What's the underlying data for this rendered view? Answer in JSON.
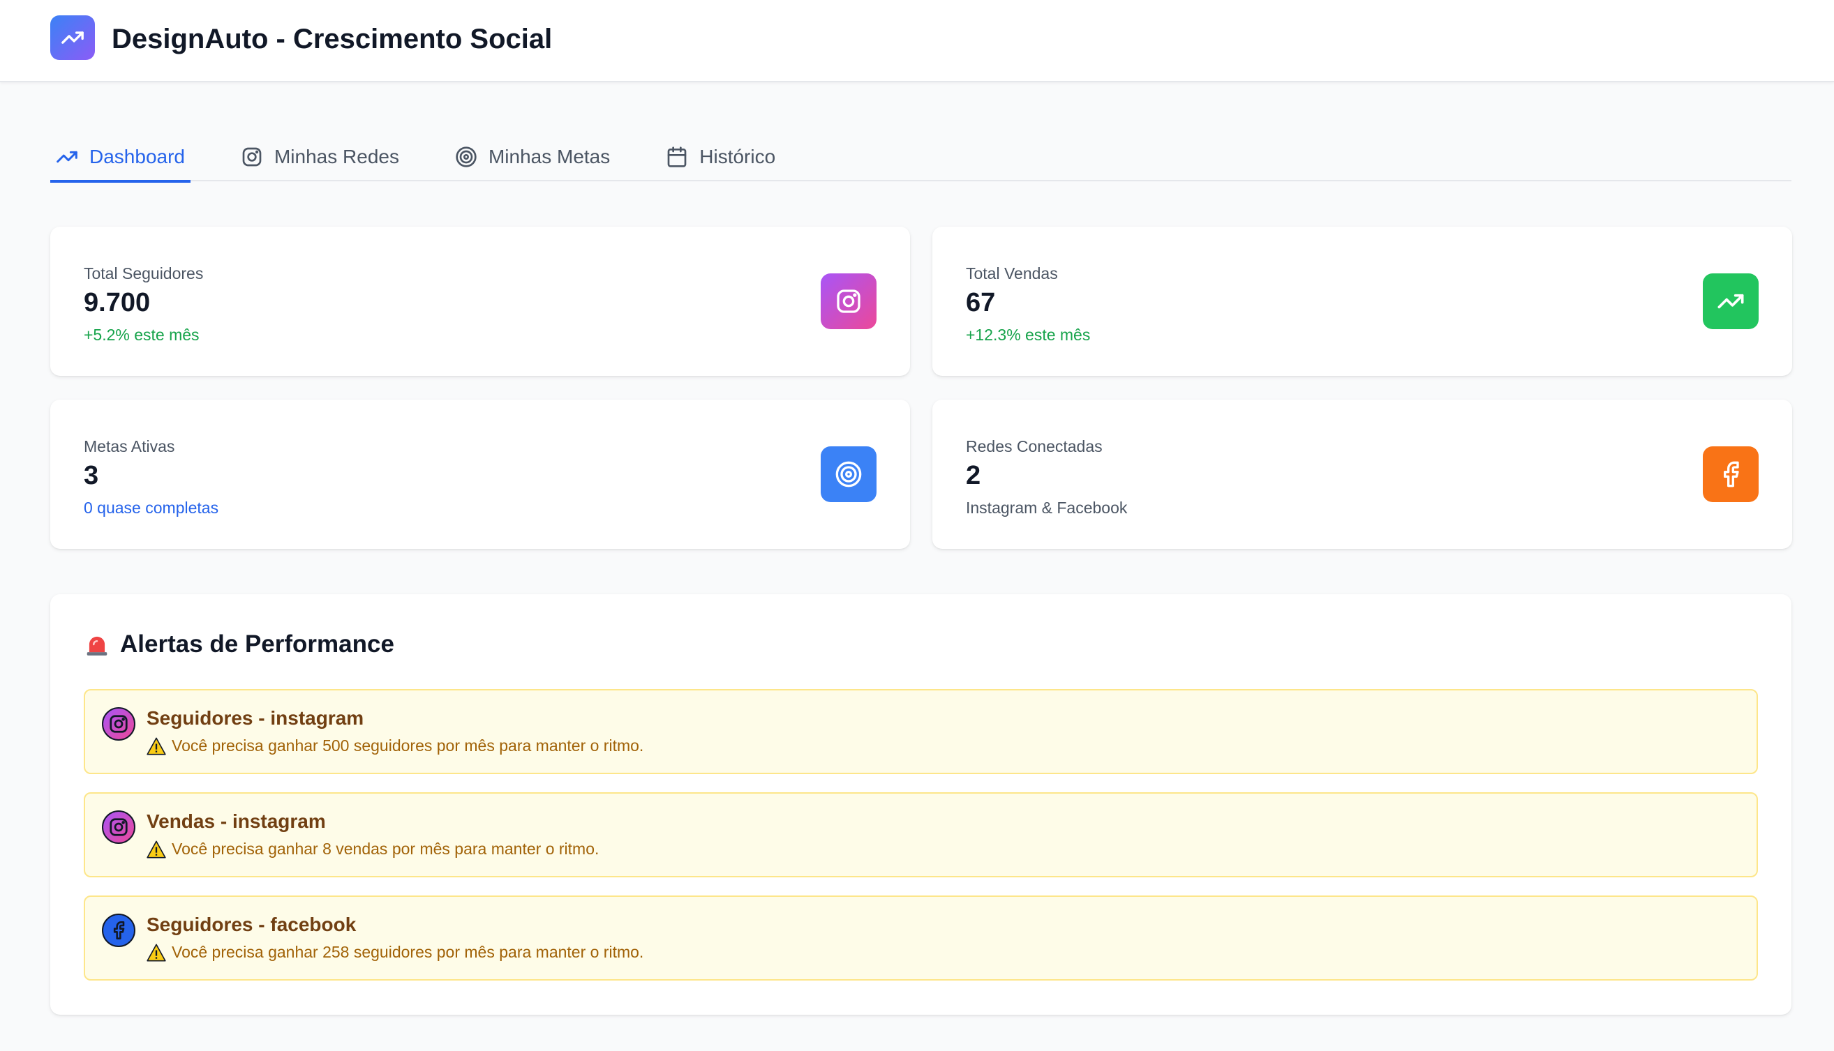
{
  "header": {
    "title": "DesignAuto - Crescimento Social",
    "logo_icon": "trending-up-icon"
  },
  "tabs": [
    {
      "label": "Dashboard",
      "icon": "trending-up-icon",
      "active": true
    },
    {
      "label": "Minhas Redes",
      "icon": "instagram-icon",
      "active": false
    },
    {
      "label": "Minhas Metas",
      "icon": "target-icon",
      "active": false
    },
    {
      "label": "Histórico",
      "icon": "calendar-icon",
      "active": false
    }
  ],
  "stats": [
    {
      "label": "Total Seguidores",
      "value": "9.700",
      "sub": "+5.2% este mês",
      "icon": "instagram-icon"
    },
    {
      "label": "Total Vendas",
      "value": "67",
      "sub": "+12.3% este mês",
      "icon": "trending-up-icon"
    },
    {
      "label": "Metas Ativas",
      "value": "3",
      "sub": "0 quase completas",
      "icon": "target-icon"
    },
    {
      "label": "Redes Conectadas",
      "value": "2",
      "sub": "Instagram & Facebook",
      "icon": "facebook-icon"
    }
  ],
  "alerts": {
    "title": "Alertas de Performance",
    "items": [
      {
        "title": "Seguidores - instagram",
        "message": "Você precisa ganhar 500 seguidores por mês para manter o ritmo.",
        "icon": "instagram-icon"
      },
      {
        "title": "Vendas - instagram",
        "message": "Você precisa ganhar 8 vendas por mês para manter o ritmo.",
        "icon": "instagram-icon"
      },
      {
        "title": "Seguidores - facebook",
        "message": "Você precisa ganhar 258 seguidores por mês para manter o ritmo.",
        "icon": "facebook-icon"
      }
    ]
  },
  "colors": {
    "accent": "#2563eb",
    "instagram_gradient": [
      "#a855f7",
      "#ec4899"
    ],
    "sales_green": "#22c55e",
    "goals_blue": "#3b82f6",
    "networks_orange": "#f97316",
    "alert_bg": "#fefce8"
  }
}
